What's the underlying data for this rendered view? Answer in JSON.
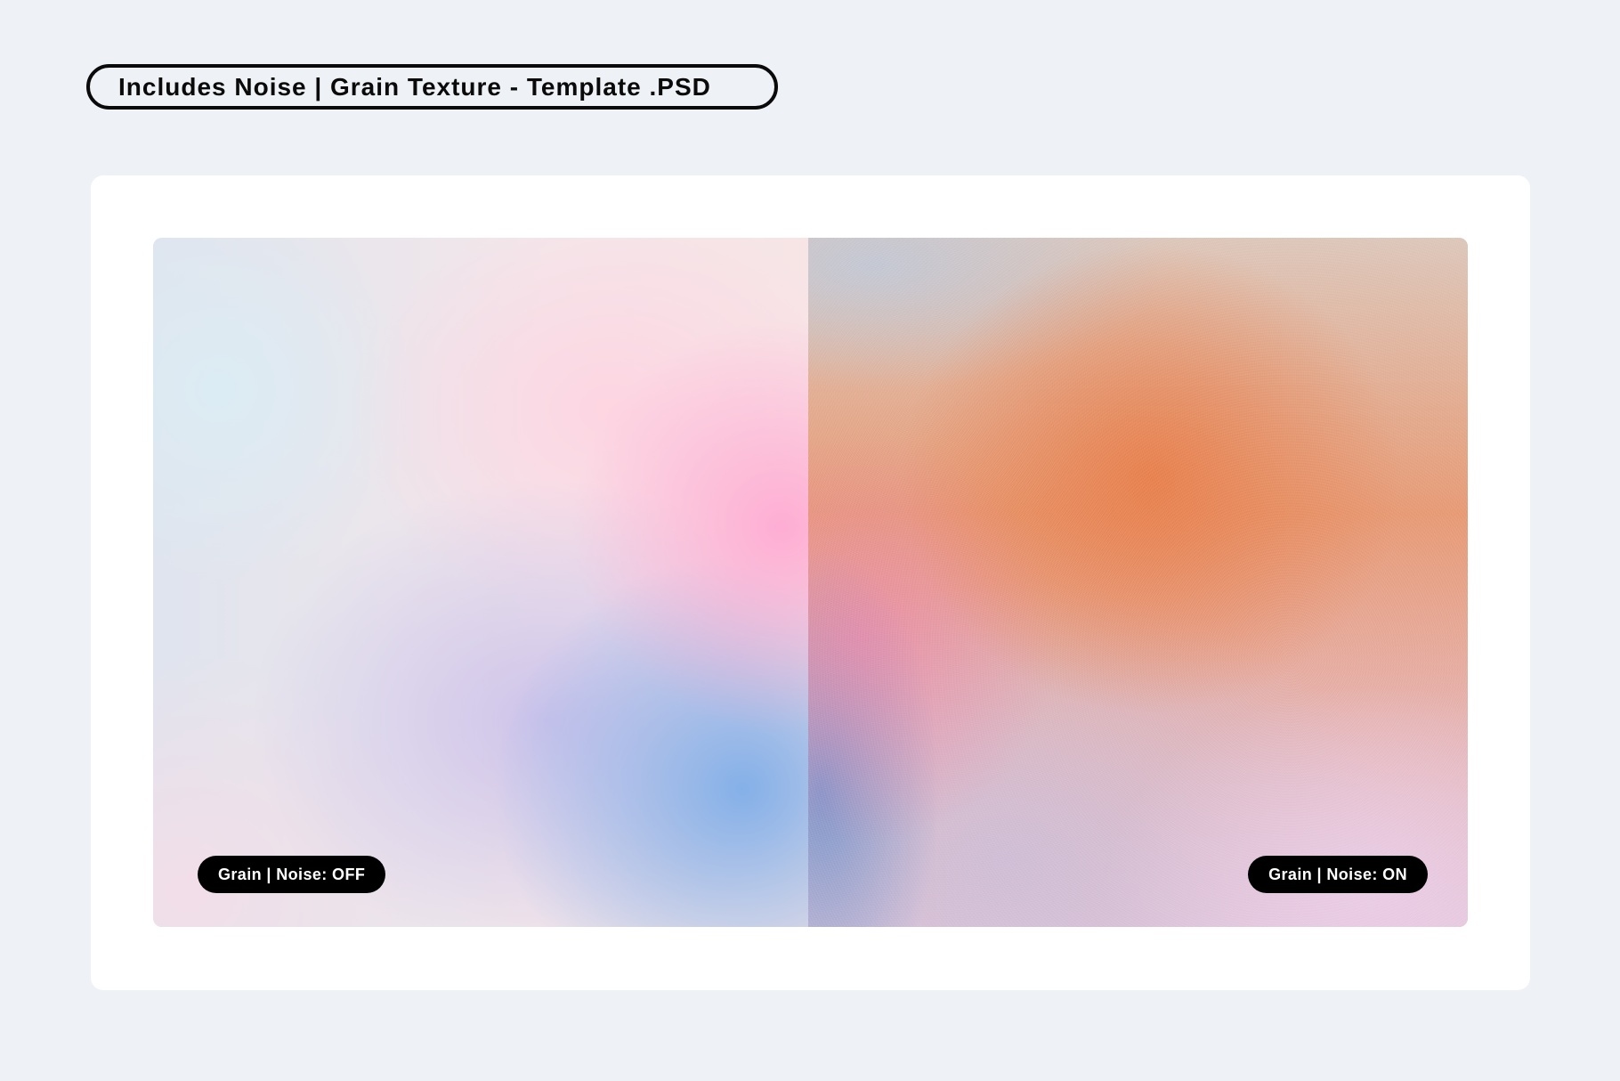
{
  "header": {
    "title": "Includes Noise | Grain Texture - Template .PSD"
  },
  "preview": {
    "left": {
      "badge_label": "Grain | Noise: OFF"
    },
    "right": {
      "badge_label": "Grain | Noise: ON"
    }
  },
  "colors": {
    "background": "#eef1f6",
    "card": "#ffffff",
    "badge": "#000000",
    "badge_text": "#ffffff",
    "pill_border": "#0a0a0a"
  }
}
